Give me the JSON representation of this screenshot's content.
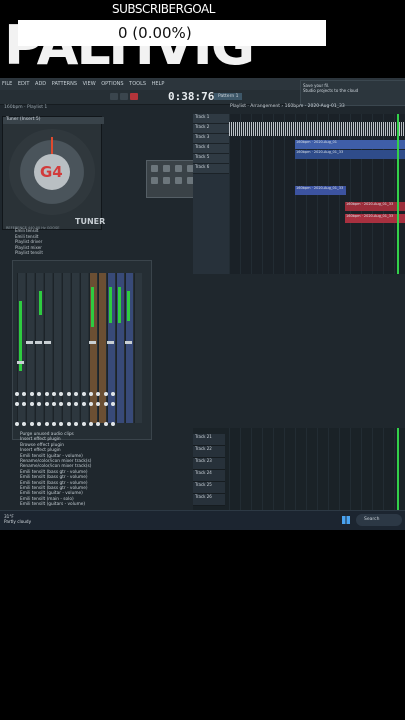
{
  "overlay": {
    "subscriber_label": "SUBSCRIBERGOAL",
    "count_text": "0 (0.00%)",
    "big_text": "PALTIVIG"
  },
  "menu": [
    "FILE",
    "EDIT",
    "ADD",
    "PATTERNS",
    "VIEW",
    "OPTIONS",
    "TOOLS",
    "HELP"
  ],
  "transport": {
    "time": "0:38:76",
    "pattern": "Pattern 1"
  },
  "song": {
    "name": "160bpm",
    "sub": "Playlist 1"
  },
  "hint": {
    "line1": "Save your fil.",
    "line2": "Studio projects to the cloud"
  },
  "tuner": {
    "title": "Tuner (Insert 5)",
    "note": "G4",
    "label": "TUNER",
    "footer": "REFERENCE 440.00 Hz  GOOSE"
  },
  "browser": [
    "Emili tensilt",
    "Emili tensilt",
    "Playlist driver",
    "Playlist mixer",
    "Playlist tensilt"
  ],
  "playlist": {
    "title": "Playlist · Arrangement › 160bpm · 2020-Aug-01_33",
    "tracks": [
      "Track 1",
      "Track 2",
      "Track 3",
      "Track 4",
      "Track 5",
      "Track 6"
    ],
    "clips": [
      {
        "text": "160bpm · 2020-Aug_01",
        "color": "#3f5ea8"
      },
      {
        "text": "160bpm · 2020-Aug_01_33",
        "color": "#2f4c8a"
      },
      {
        "text": "160bpm · 2020-Aug_01_33",
        "color": "#3c53a0"
      },
      {
        "text": "160bpm · 2020-Aug_01_33",
        "color": "#9b2d3a"
      },
      {
        "text": "160bpm · 2020-Aug_01_33",
        "color": "#a8303f"
      }
    ]
  },
  "lowerlist": [
    "Purge unused audio clips",
    "Insert effect plugin",
    "Browse effect plugin",
    "Insert effect plugin",
    "Emili tensilt (guitar - volume)",
    "Rename/color/icon mixer track(s)",
    "Rename/color/icon mixer track(s)",
    "Emili tensilt (bass gtr - volume)",
    "Emili tensilt (bass gtr - volume)",
    "Emili tensilt (bass gtr - volume)",
    "Emili tensilt (bass gtr - volume)",
    "Emili tensilt (guitar - volume)",
    "Emili tensilt (main - solo)",
    "Emili tensilt (guitars - volume)"
  ],
  "lowertracks": [
    "Track 21",
    "Track 22",
    "Track 23",
    "Track 24",
    "Track 25",
    "Track 26"
  ],
  "taskbar": {
    "weather_temp": "31°F",
    "weather_desc": "Partly cloudy",
    "search": "Search"
  }
}
